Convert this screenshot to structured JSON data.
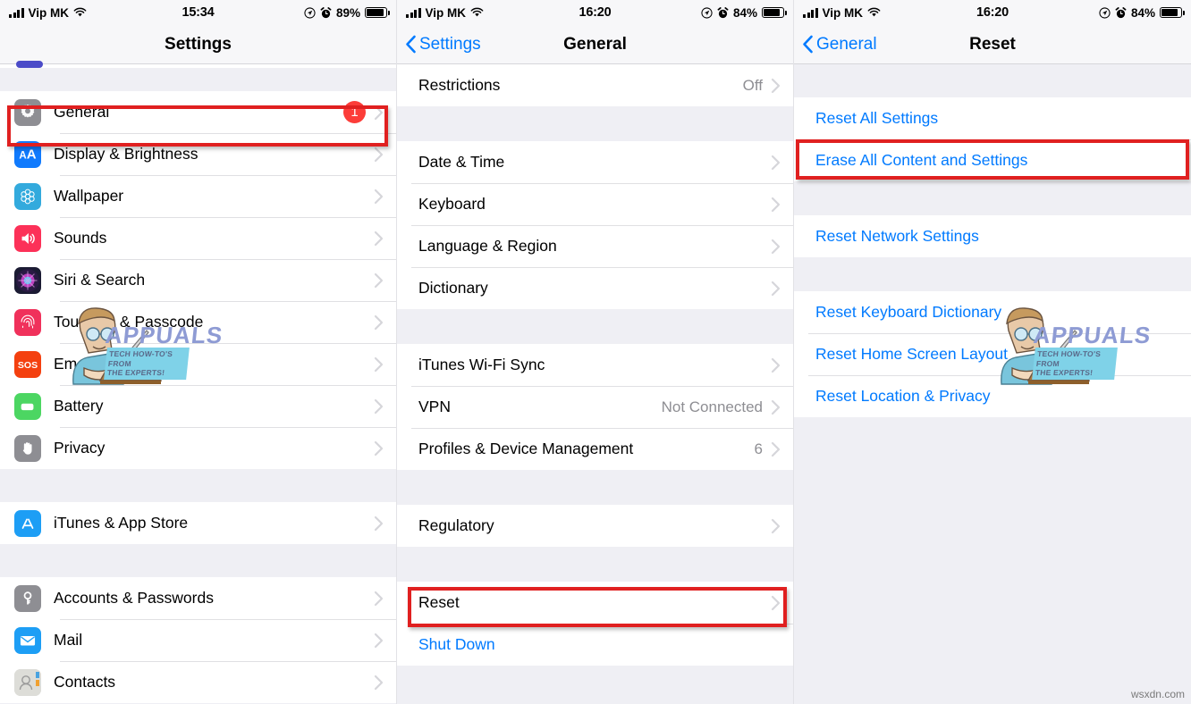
{
  "panels": [
    {
      "status": {
        "carrier": "Vip MK",
        "time": "15:34",
        "battery_pct": "89%"
      },
      "nav": {
        "title": "Settings",
        "back": ""
      },
      "rows": [
        {
          "label": "General",
          "badge": "1",
          "icon": "gear-icon"
        },
        {
          "label": "Display & Brightness",
          "icon": "display-brightness-icon"
        },
        {
          "label": "Wallpaper",
          "icon": "wallpaper-icon"
        },
        {
          "label": "Sounds",
          "icon": "sounds-icon"
        },
        {
          "label": "Siri & Search",
          "icon": "siri-icon"
        },
        {
          "label": "Touch ID & Passcode",
          "icon": "touch-id-icon"
        },
        {
          "label": "Emergency SOS",
          "icon": "emergency-sos-icon"
        },
        {
          "label": "Battery",
          "icon": "battery-icon"
        },
        {
          "label": "Privacy",
          "icon": "privacy-hand-icon"
        },
        {
          "label": "iTunes & App Store",
          "icon": "app-store-icon"
        },
        {
          "label": "Accounts & Passwords",
          "icon": "key-icon"
        },
        {
          "label": "Mail",
          "icon": "mail-icon"
        },
        {
          "label": "Contacts",
          "icon": "contacts-icon"
        }
      ]
    },
    {
      "status": {
        "carrier": "Vip MK",
        "time": "16:20",
        "battery_pct": "84%"
      },
      "nav": {
        "title": "General",
        "back": "Settings"
      },
      "rows": [
        {
          "label": "Restrictions",
          "detail": "Off"
        },
        {
          "label": "Date & Time"
        },
        {
          "label": "Keyboard"
        },
        {
          "label": "Language & Region"
        },
        {
          "label": "Dictionary"
        },
        {
          "label": "iTunes Wi-Fi Sync"
        },
        {
          "label": "VPN",
          "detail": "Not Connected"
        },
        {
          "label": "Profiles & Device Management",
          "detail": "6"
        },
        {
          "label": "Regulatory"
        },
        {
          "label": "Reset"
        },
        {
          "label": "Shut Down",
          "blue": true,
          "nochev": true
        }
      ]
    },
    {
      "status": {
        "carrier": "Vip MK",
        "time": "16:20",
        "battery_pct": "84%"
      },
      "nav": {
        "title": "Reset",
        "back": "General"
      },
      "rows": [
        {
          "label": "Reset All Settings"
        },
        {
          "label": "Erase All Content and Settings"
        },
        {
          "label": "Reset Network Settings"
        },
        {
          "label": "Reset Keyboard Dictionary"
        },
        {
          "label": "Reset Home Screen Layout"
        },
        {
          "label": "Reset Location & Privacy"
        }
      ]
    }
  ],
  "watermark": {
    "brand": "APPUALS",
    "line1": "TECH HOW-TO'S FROM",
    "line2": "THE EXPERTS!",
    "corner": "wsxdn.com"
  },
  "colors": {
    "accent_blue": "#007aff",
    "highlight_red": "#e02020",
    "badge_red": "#fc3d39",
    "group_bg": "#efeff4"
  }
}
